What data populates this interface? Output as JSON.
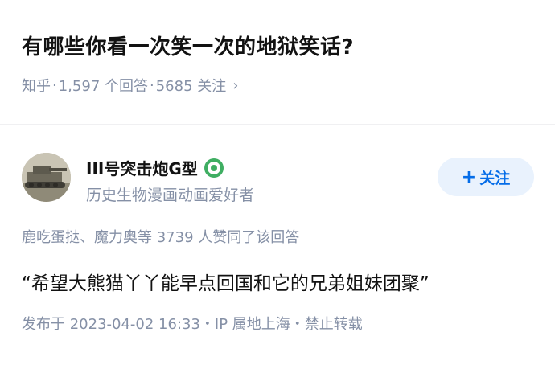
{
  "question": {
    "title": "有哪些你看一次笑一次的地狱笑话?",
    "source": "知乎",
    "answers_count": "1,597 个回答",
    "followers_count": "5685 关注",
    "separator": "·",
    "chevron": "›"
  },
  "author": {
    "name": "III号突击炮G型",
    "badge_icon": "green-badge-icon",
    "badge_color": "#3fae62",
    "bio": "历史生物漫画动画爱好者",
    "avatar_icon": "tank-avatar"
  },
  "follow_button": {
    "plus": "+",
    "label": "关注",
    "color": "#056de8",
    "background": "#e9f2fd"
  },
  "upvoters": "鹿吃蛋挞、魔力奥等 3739 人赞同了该回答",
  "answer_text": "“希望大熊猫丫丫能早点回国和它的兄弟姐妹团聚”",
  "post_meta": "发布于 2023-04-02 16:33・IP 属地上海・禁止转载"
}
